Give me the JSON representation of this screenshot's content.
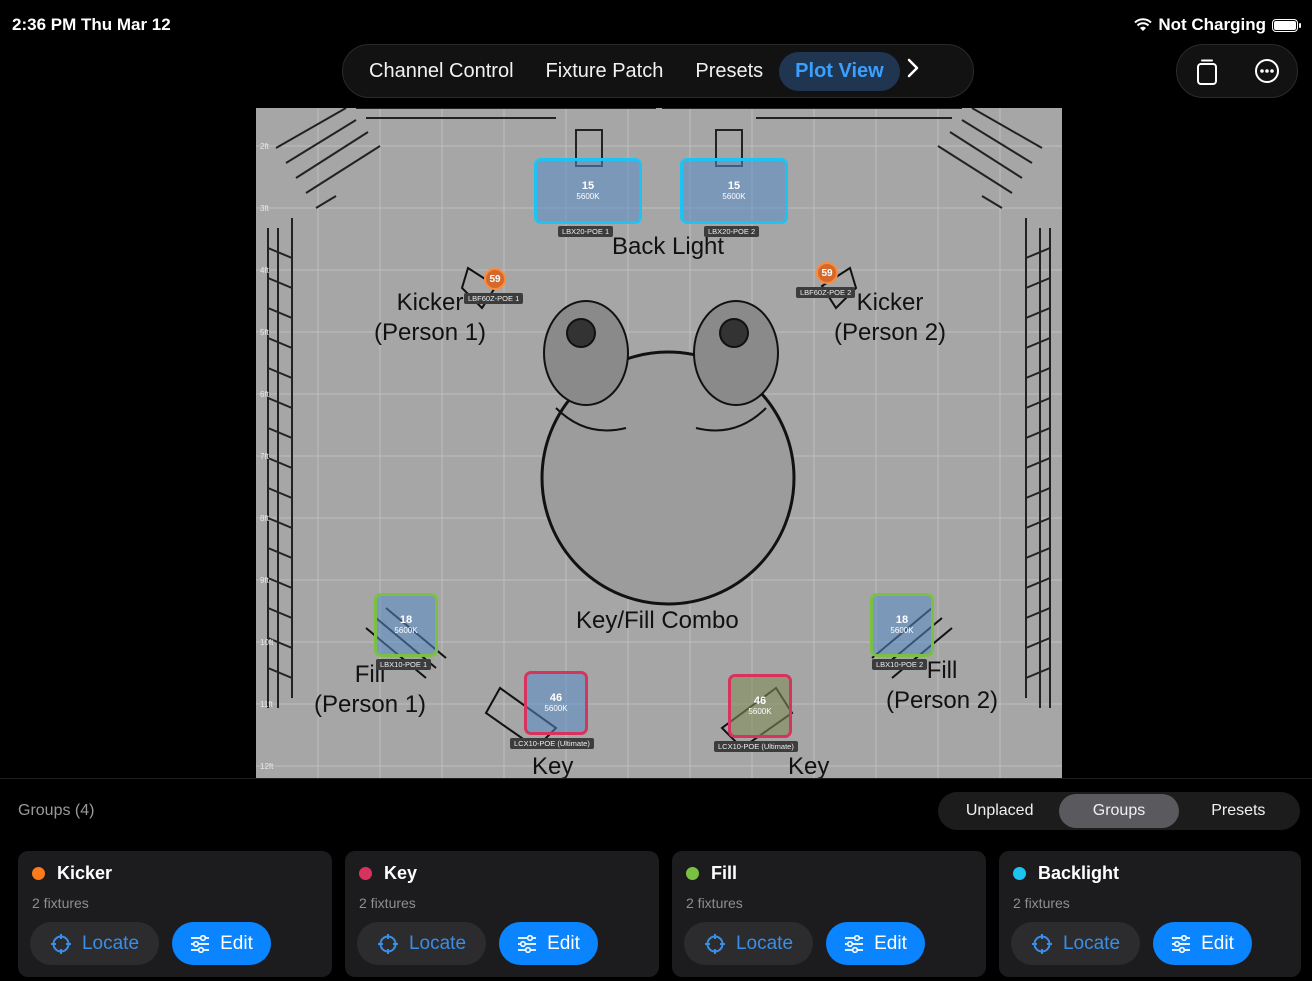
{
  "status": {
    "time": "2:36 PM  Thu Mar 12",
    "battery_text": "Not Charging"
  },
  "tabs": [
    {
      "label": "Channel Control"
    },
    {
      "label": "Fixture Patch"
    },
    {
      "label": "Presets"
    },
    {
      "label": "Plot View",
      "active": true
    }
  ],
  "icons": {
    "tab_next": "chevron-right-icon",
    "top_actions": [
      "clipboard-icon",
      "more-icon"
    ]
  },
  "plot": {
    "grid_labels": [
      "2ft",
      "3ft",
      "4ft",
      "5ft",
      "6ft",
      "7ft",
      "8ft",
      "9ft",
      "10ft",
      "11ft",
      "12ft"
    ],
    "stage_text": {
      "back_light": "Back Light",
      "kicker_1": "Kicker\n(Person 1)",
      "kicker_2": "Kicker\n(Person 2)",
      "key_fill": "Key/Fill Combo",
      "fill_1": "Fill\n(Person 1)",
      "fill_2": "Fill\n(Person 2)",
      "key_1": "Key",
      "key_2": "Key"
    },
    "fixtures": {
      "lbx20_1": {
        "level": "15",
        "cct": "5600K",
        "name": "LBX20-POE 1"
      },
      "lbx20_2": {
        "level": "15",
        "cct": "5600K",
        "name": "LBX20-POE 2"
      },
      "lbf_1": {
        "level": "59",
        "name": "LBF60Z-POE 1"
      },
      "lbf_2": {
        "level": "59",
        "name": "LBF60Z-POE 2"
      },
      "lbx10_1": {
        "level": "18",
        "cct": "5600K",
        "name": "LBX10-POE 1"
      },
      "lbx10_2": {
        "level": "18",
        "cct": "5600K",
        "name": "LBX10-POE 2"
      },
      "lcx_1": {
        "level": "46",
        "cct": "5600K",
        "name": "LCX10-POE (Ultimate)"
      },
      "lcx_2": {
        "level": "46",
        "cct": "5600K",
        "name": "LCX10-POE (Ultimate)"
      }
    }
  },
  "groups_title": "Groups (4)",
  "segments": [
    {
      "label": "Unplaced"
    },
    {
      "label": "Groups",
      "active": true
    },
    {
      "label": "Presets"
    }
  ],
  "groups": [
    {
      "name": "Kicker",
      "count": "2 fixtures",
      "color": "#ff7a1a",
      "locate": "Locate",
      "edit": "Edit"
    },
    {
      "name": "Key",
      "count": "2 fixtures",
      "color": "#d6335f",
      "locate": "Locate",
      "edit": "Edit"
    },
    {
      "name": "Fill",
      "count": "2 fixtures",
      "color": "#7ac143",
      "locate": "Locate",
      "edit": "Edit"
    },
    {
      "name": "Backlight",
      "count": "2 fixtures",
      "color": "#1ec3f2",
      "locate": "Locate",
      "edit": "Edit"
    }
  ],
  "colors": {
    "accent": "#0a84ff",
    "backlight": "#1ec3f2",
    "fill": "#7ac143",
    "key": "#d6335f",
    "kicker": "#ff7a1a"
  }
}
